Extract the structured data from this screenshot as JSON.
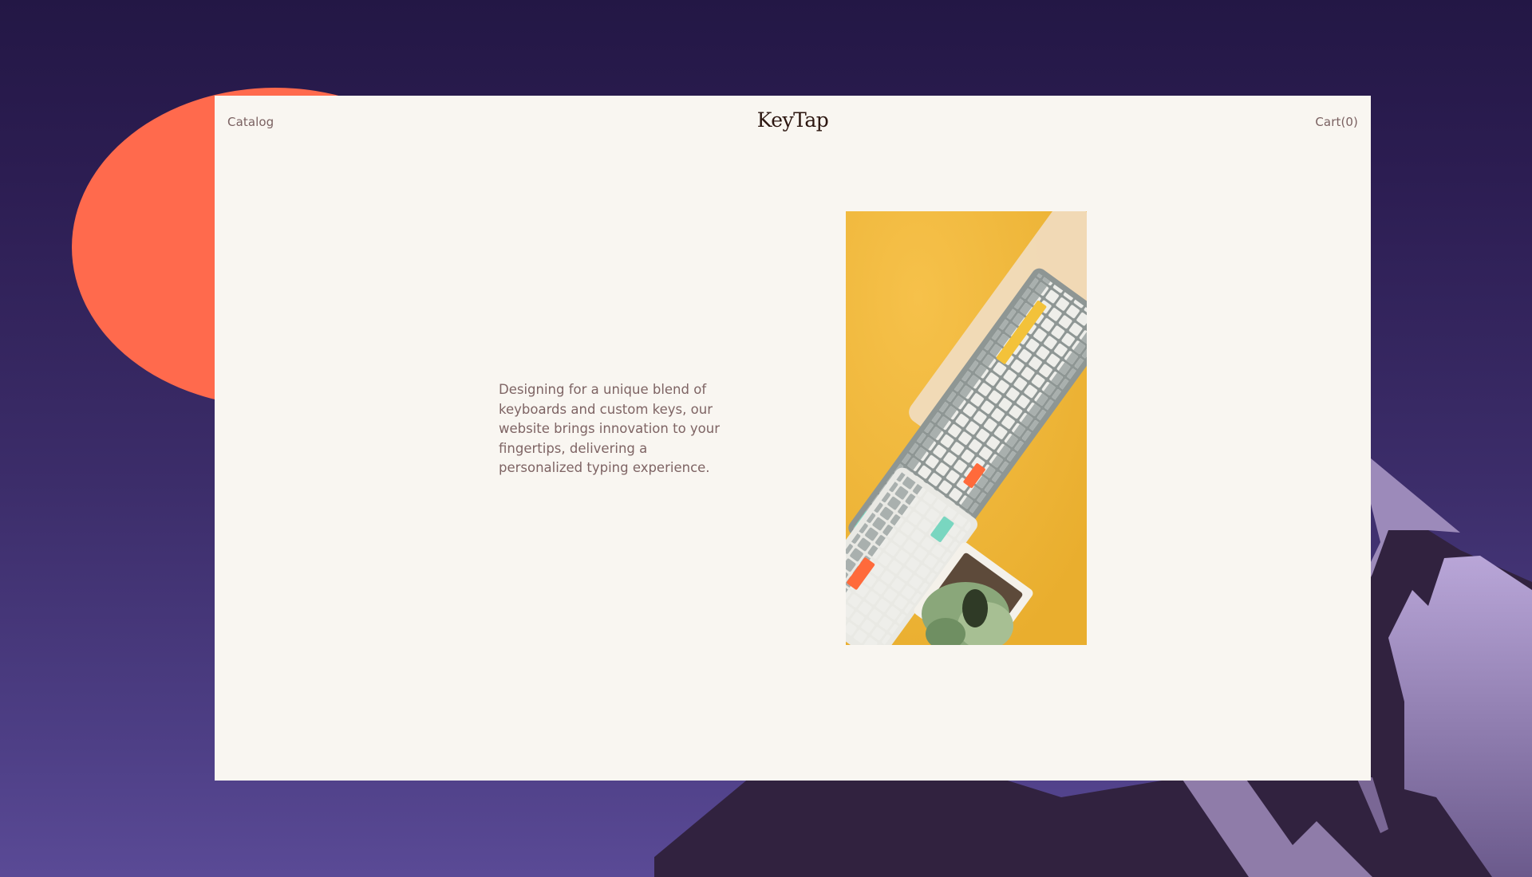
{
  "header": {
    "nav_left": "Catalog",
    "logo": "KeyTap",
    "cart_label": "Cart(0)"
  },
  "hero": {
    "tagline": "Designing for a unique blend of keyboards and custom keys, our website brings innovation to your fingertips, delivering a personalized typing experience.",
    "image_alt": "Keyboards with grey, white, orange and mint keycaps on a yellow background"
  },
  "colors": {
    "background_top": "#231745",
    "background_bottom": "#5a4a96",
    "sun": "#ff6a4d",
    "card": "#f9f6f1",
    "text_muted": "#7e6464",
    "logo_text": "#2c1610",
    "image_bg": "#f2b93b",
    "accent_orange": "#ff6a3b",
    "accent_mint": "#79d6c0"
  }
}
